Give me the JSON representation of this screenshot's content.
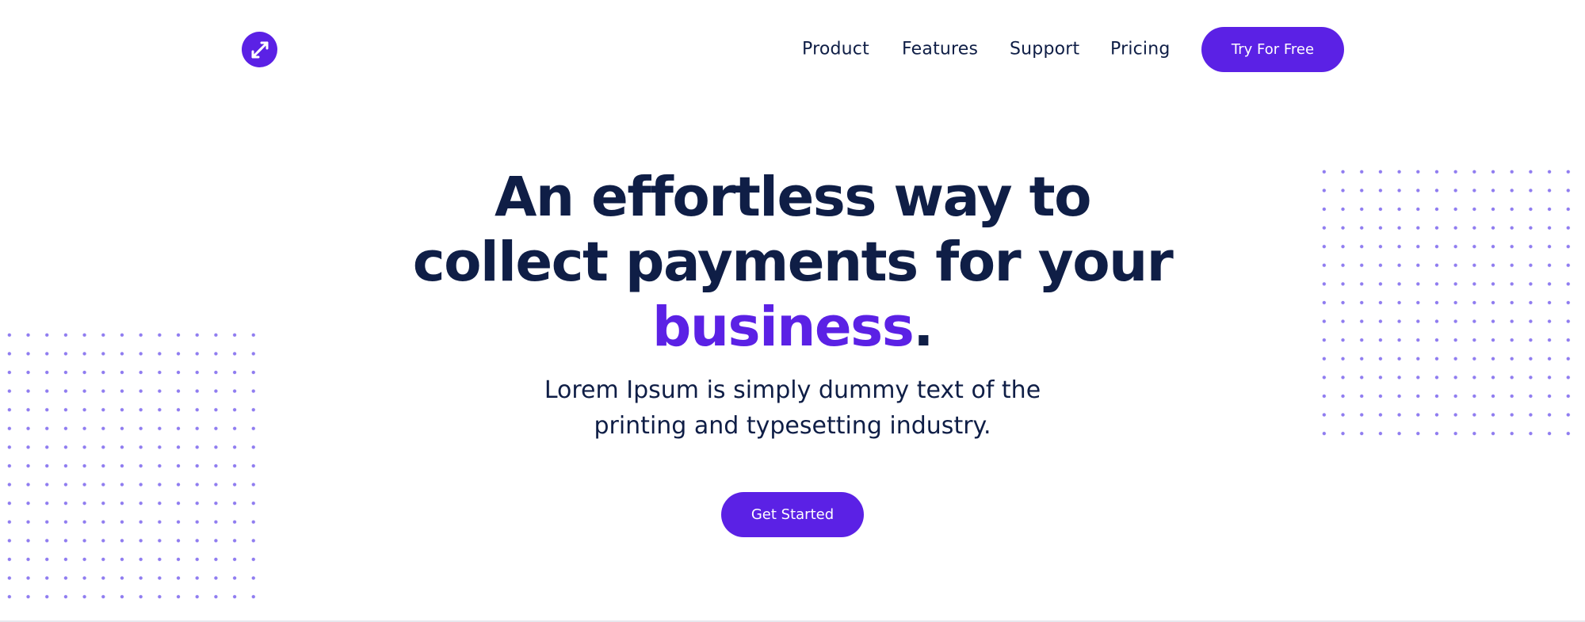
{
  "brand": {
    "logo_icon": "double-chevron-arrows-icon",
    "color": "#5b21e5"
  },
  "nav": {
    "items": [
      {
        "label": "Product"
      },
      {
        "label": "Features"
      },
      {
        "label": "Support"
      },
      {
        "label": "Pricing"
      }
    ],
    "cta_label": "Try For Free"
  },
  "hero": {
    "headline_line1": "An effortless way to",
    "headline_line2": "collect payments for your",
    "headline_accent": "business",
    "headline_punct": ".",
    "subtext_line1": "Lorem Ipsum is simply dummy text of the",
    "subtext_line2": "printing and typesetting industry.",
    "cta_label": "Get Started"
  },
  "colors": {
    "primary": "#5b21e5",
    "text": "#0f1e46",
    "dots": "#8f7cf0",
    "background": "#ffffff"
  }
}
